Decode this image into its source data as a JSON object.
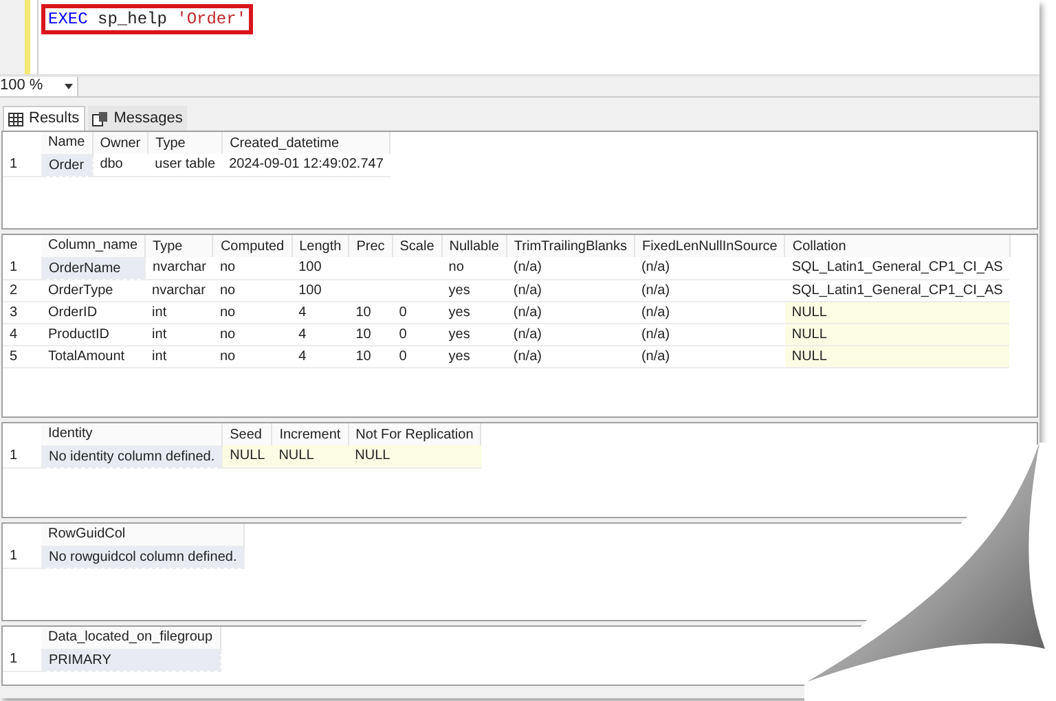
{
  "editor": {
    "tokens": [
      {
        "text": "EXEC",
        "kind": "keyword"
      },
      {
        "text": "sp_help",
        "kind": "identifier"
      },
      {
        "text": "'Order'",
        "kind": "string"
      }
    ]
  },
  "zoom": {
    "value": "100 %"
  },
  "tabs": [
    {
      "label": "Results",
      "selected": true,
      "kind": "grid"
    },
    {
      "label": "Messages",
      "selected": false,
      "kind": "messages"
    }
  ],
  "grids": [
    {
      "columns": [
        "Name",
        "Owner",
        "Type",
        "Created_datetime"
      ],
      "rows": [
        {
          "number": "1",
          "cells": [
            {
              "text": "Order",
              "null": false,
              "selected": true
            },
            {
              "text": "dbo",
              "null": false,
              "selected": false
            },
            {
              "text": "user table",
              "null": false,
              "selected": false
            },
            {
              "text": "2024-09-01 12:49:02.747",
              "null": false,
              "selected": false
            }
          ]
        }
      ]
    },
    {
      "columns": [
        "Column_name",
        "Type",
        "Computed",
        "Length",
        "Prec",
        "Scale",
        "Nullable",
        "TrimTrailingBlanks",
        "FixedLenNullInSource",
        "Collation"
      ],
      "rows": [
        {
          "number": "1",
          "cells": [
            {
              "text": "OrderName",
              "null": false,
              "selected": true
            },
            {
              "text": "nvarchar",
              "null": false,
              "selected": false
            },
            {
              "text": "no",
              "null": false,
              "selected": false
            },
            {
              "text": "100",
              "null": false,
              "selected": false
            },
            {
              "null": false,
              "selected": false
            },
            {
              "null": false,
              "selected": false
            },
            {
              "text": "no",
              "null": false,
              "selected": false
            },
            {
              "text": "(n/a)",
              "null": false,
              "selected": false
            },
            {
              "text": "(n/a)",
              "null": false,
              "selected": false
            },
            {
              "text": "SQL_Latin1_General_CP1_CI_AS",
              "null": false,
              "selected": false
            }
          ]
        },
        {
          "number": "2",
          "cells": [
            {
              "text": "OrderType",
              "null": false,
              "selected": false
            },
            {
              "text": "nvarchar",
              "null": false,
              "selected": false
            },
            {
              "text": "no",
              "null": false,
              "selected": false
            },
            {
              "text": "100",
              "null": false,
              "selected": false
            },
            {
              "null": false,
              "selected": false
            },
            {
              "null": false,
              "selected": false
            },
            {
              "text": "yes",
              "null": false,
              "selected": false
            },
            {
              "text": "(n/a)",
              "null": false,
              "selected": false
            },
            {
              "text": "(n/a)",
              "null": false,
              "selected": false
            },
            {
              "text": "SQL_Latin1_General_CP1_CI_AS",
              "null": false,
              "selected": false
            }
          ]
        },
        {
          "number": "3",
          "cells": [
            {
              "text": "OrderID",
              "null": false,
              "selected": false
            },
            {
              "text": "int",
              "null": false,
              "selected": false
            },
            {
              "text": "no",
              "null": false,
              "selected": false
            },
            {
              "text": "4",
              "null": false,
              "selected": false
            },
            {
              "text": "10",
              "null": false,
              "selected": false
            },
            {
              "text": "0",
              "null": false,
              "selected": false
            },
            {
              "text": "yes",
              "null": false,
              "selected": false
            },
            {
              "text": "(n/a)",
              "null": false,
              "selected": false
            },
            {
              "text": "(n/a)",
              "null": false,
              "selected": false
            },
            {
              "text": "NULL",
              "null": true,
              "selected": false
            }
          ]
        },
        {
          "number": "4",
          "cells": [
            {
              "text": "ProductID",
              "null": false,
              "selected": false
            },
            {
              "text": "int",
              "null": false,
              "selected": false
            },
            {
              "text": "no",
              "null": false,
              "selected": false
            },
            {
              "text": "4",
              "null": false,
              "selected": false
            },
            {
              "text": "10",
              "null": false,
              "selected": false
            },
            {
              "text": "0",
              "null": false,
              "selected": false
            },
            {
              "text": "yes",
              "null": false,
              "selected": false
            },
            {
              "text": "(n/a)",
              "null": false,
              "selected": false
            },
            {
              "text": "(n/a)",
              "null": false,
              "selected": false
            },
            {
              "text": "NULL",
              "null": true,
              "selected": false
            }
          ]
        },
        {
          "number": "5",
          "cells": [
            {
              "text": "TotalAmount",
              "null": false,
              "selected": false
            },
            {
              "text": "int",
              "null": false,
              "selected": false
            },
            {
              "text": "no",
              "null": false,
              "selected": false
            },
            {
              "text": "4",
              "null": false,
              "selected": false
            },
            {
              "text": "10",
              "null": false,
              "selected": false
            },
            {
              "text": "0",
              "null": false,
              "selected": false
            },
            {
              "text": "yes",
              "null": false,
              "selected": false
            },
            {
              "text": "(n/a)",
              "null": false,
              "selected": false
            },
            {
              "text": "(n/a)",
              "null": false,
              "selected": false
            },
            {
              "text": "NULL",
              "null": true,
              "selected": false
            }
          ]
        }
      ]
    },
    {
      "columns": [
        "Identity",
        "Seed",
        "Increment",
        "Not For Replication"
      ],
      "rows": [
        {
          "number": "1",
          "cells": [
            {
              "text": "No identity column defined.",
              "null": false,
              "selected": true
            },
            {
              "text": "NULL",
              "null": true,
              "selected": false
            },
            {
              "text": "NULL",
              "null": true,
              "selected": false
            },
            {
              "text": "NULL",
              "null": true,
              "selected": false
            }
          ]
        }
      ]
    },
    {
      "columns": [
        "RowGuidCol"
      ],
      "rows": [
        {
          "number": "1",
          "cells": [
            {
              "text": "No rowguidcol column defined.",
              "null": false,
              "selected": true
            }
          ]
        }
      ]
    },
    {
      "columns": [
        "Data_located_on_filegroup"
      ],
      "rows": [
        {
          "number": "1",
          "cells": [
            {
              "text": "PRIMARY",
              "null": false,
              "selected": true
            }
          ]
        }
      ]
    }
  ]
}
